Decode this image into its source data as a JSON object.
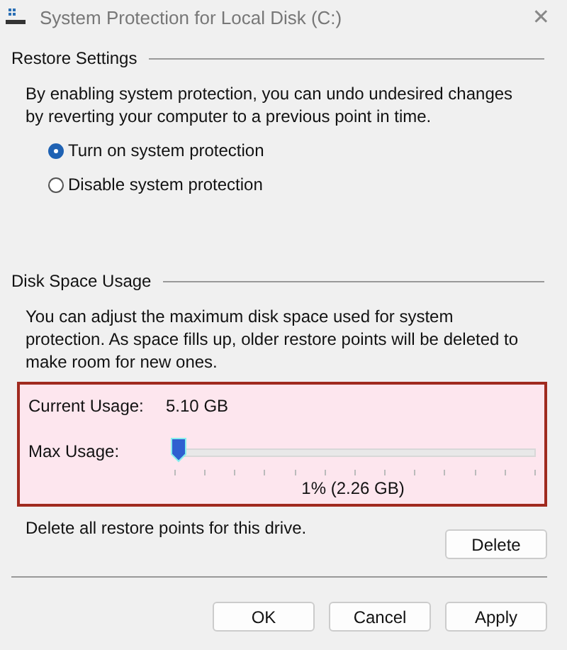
{
  "window": {
    "title": "System Protection for Local Disk (C:)",
    "close": "✕"
  },
  "restore_settings": {
    "heading": "Restore Settings",
    "description": "By enabling system protection, you can undo undesired changes by reverting your computer to a previous point in time.",
    "options": [
      {
        "label": "Turn on system protection",
        "selected": true
      },
      {
        "label": "Disable system protection",
        "selected": false
      }
    ]
  },
  "disk_space_usage": {
    "heading": "Disk Space Usage",
    "description": "You can adjust the maximum disk space used for system protection. As space fills up, older restore points will be deleted to make room for new ones.",
    "current_usage": {
      "label": "Current Usage:",
      "value": "5.10 GB"
    },
    "max_usage": {
      "label": "Max Usage:",
      "level": 0.01,
      "reading": "1% (2.26 GB)"
    }
  },
  "delete": {
    "description": "Delete all restore points for this drive.",
    "button": "Delete"
  },
  "buttons": [
    "OK",
    "Cancel",
    "Apply"
  ]
}
